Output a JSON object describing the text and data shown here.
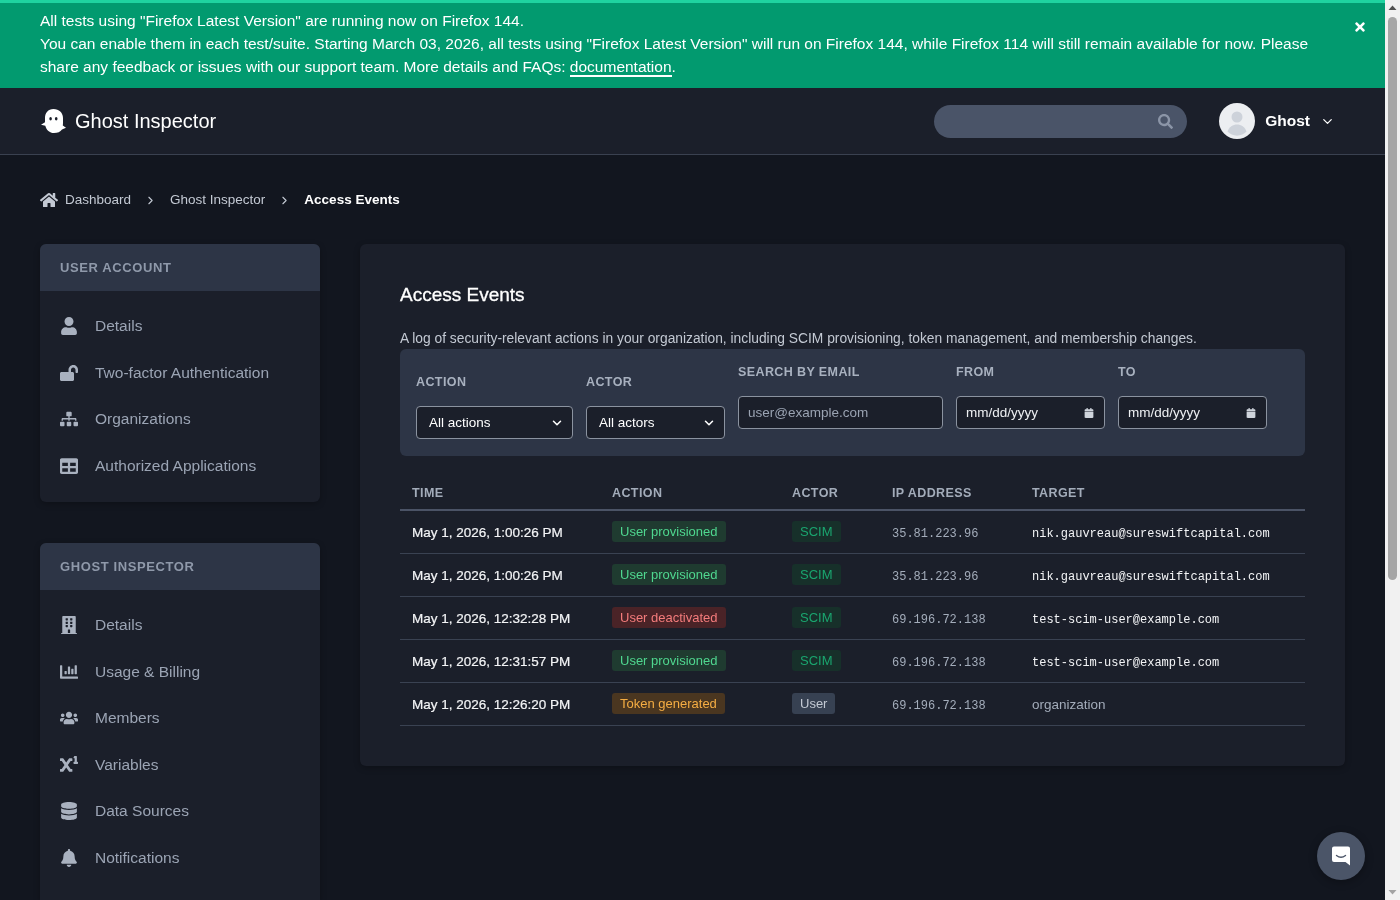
{
  "banner": {
    "headline": "All tests using \"Firefox Latest Version\" are running now on Firefox 144.",
    "message": "You can enable them in each test/suite. Starting March 03, 2026, all tests using \"Firefox Latest Version\" will run on Firefox 144, while Firefox 114 will still remain available for now. Please share any feedback or issues with our support team. More details and FAQs:",
    "link": "documentation",
    "tail": "."
  },
  "header": {
    "brand": "Ghost Inspector",
    "user": "Ghost"
  },
  "breadcrumb": [
    {
      "label": "Dashboard",
      "current": false
    },
    {
      "label": "Ghost Inspector",
      "current": false
    },
    {
      "label": "Access Events",
      "current": true
    }
  ],
  "sidebar": {
    "sections": [
      {
        "title": "USER ACCOUNT",
        "items": [
          {
            "label": "Details"
          },
          {
            "label": "Two-factor Authentication"
          },
          {
            "label": "Organizations"
          },
          {
            "label": "Authorized Applications"
          }
        ]
      },
      {
        "title": "GHOST INSPECTOR",
        "items": [
          {
            "label": "Details"
          },
          {
            "label": "Usage & Billing"
          },
          {
            "label": "Members"
          },
          {
            "label": "Variables"
          },
          {
            "label": "Data Sources"
          },
          {
            "label": "Notifications"
          }
        ]
      }
    ]
  },
  "main": {
    "title": "Access Events",
    "description": "A log of security-relevant actions in your organization, including SCIM provisioning, token management, and membership changes.",
    "filters": [
      {
        "label": "ACTION",
        "kind": "select",
        "value": "All actions"
      },
      {
        "label": "ACTOR",
        "kind": "select",
        "value": "All actors"
      },
      {
        "label": "SEARCH BY EMAIL",
        "kind": "text",
        "placeholder": "user@example.com"
      },
      {
        "label": "FROM",
        "kind": "date",
        "placeholder": "mm/dd/yyyy"
      },
      {
        "label": "TO",
        "kind": "date",
        "placeholder": "mm/dd/yyyy"
      }
    ],
    "table": {
      "columns": [
        "TIME",
        "ACTION",
        "ACTOR",
        "IP ADDRESS",
        "TARGET"
      ],
      "rows": [
        {
          "time": "May 1, 2026, 1:00:26 PM",
          "action": {
            "label": "User provisioned",
            "kind": "success"
          },
          "actor": {
            "label": "SCIM",
            "kind": "system"
          },
          "ip": "35.81.223.96",
          "target": {
            "text": "nik.gauvreau@sureswiftcapital.com",
            "kind": "email"
          }
        },
        {
          "time": "May 1, 2026, 1:00:26 PM",
          "action": {
            "label": "User provisioned",
            "kind": "success"
          },
          "actor": {
            "label": "SCIM",
            "kind": "system"
          },
          "ip": "35.81.223.96",
          "target": {
            "text": "nik.gauvreau@sureswiftcapital.com",
            "kind": "email"
          }
        },
        {
          "time": "May 1, 2026, 12:32:28 PM",
          "action": {
            "label": "User deactivated",
            "kind": "danger"
          },
          "actor": {
            "label": "SCIM",
            "kind": "system"
          },
          "ip": "69.196.72.138",
          "target": {
            "text": "test-scim-user@example.com",
            "kind": "email"
          }
        },
        {
          "time": "May 1, 2026, 12:31:57 PM",
          "action": {
            "label": "User provisioned",
            "kind": "success"
          },
          "actor": {
            "label": "SCIM",
            "kind": "system"
          },
          "ip": "69.196.72.138",
          "target": {
            "text": "test-scim-user@example.com",
            "kind": "email"
          }
        },
        {
          "time": "May 1, 2026, 12:26:20 PM",
          "action": {
            "label": "Token generated",
            "kind": "warning"
          },
          "actor": {
            "label": "User",
            "kind": "user"
          },
          "ip": "69.196.72.138",
          "target": {
            "text": "organization",
            "kind": "resource"
          }
        }
      ]
    }
  }
}
